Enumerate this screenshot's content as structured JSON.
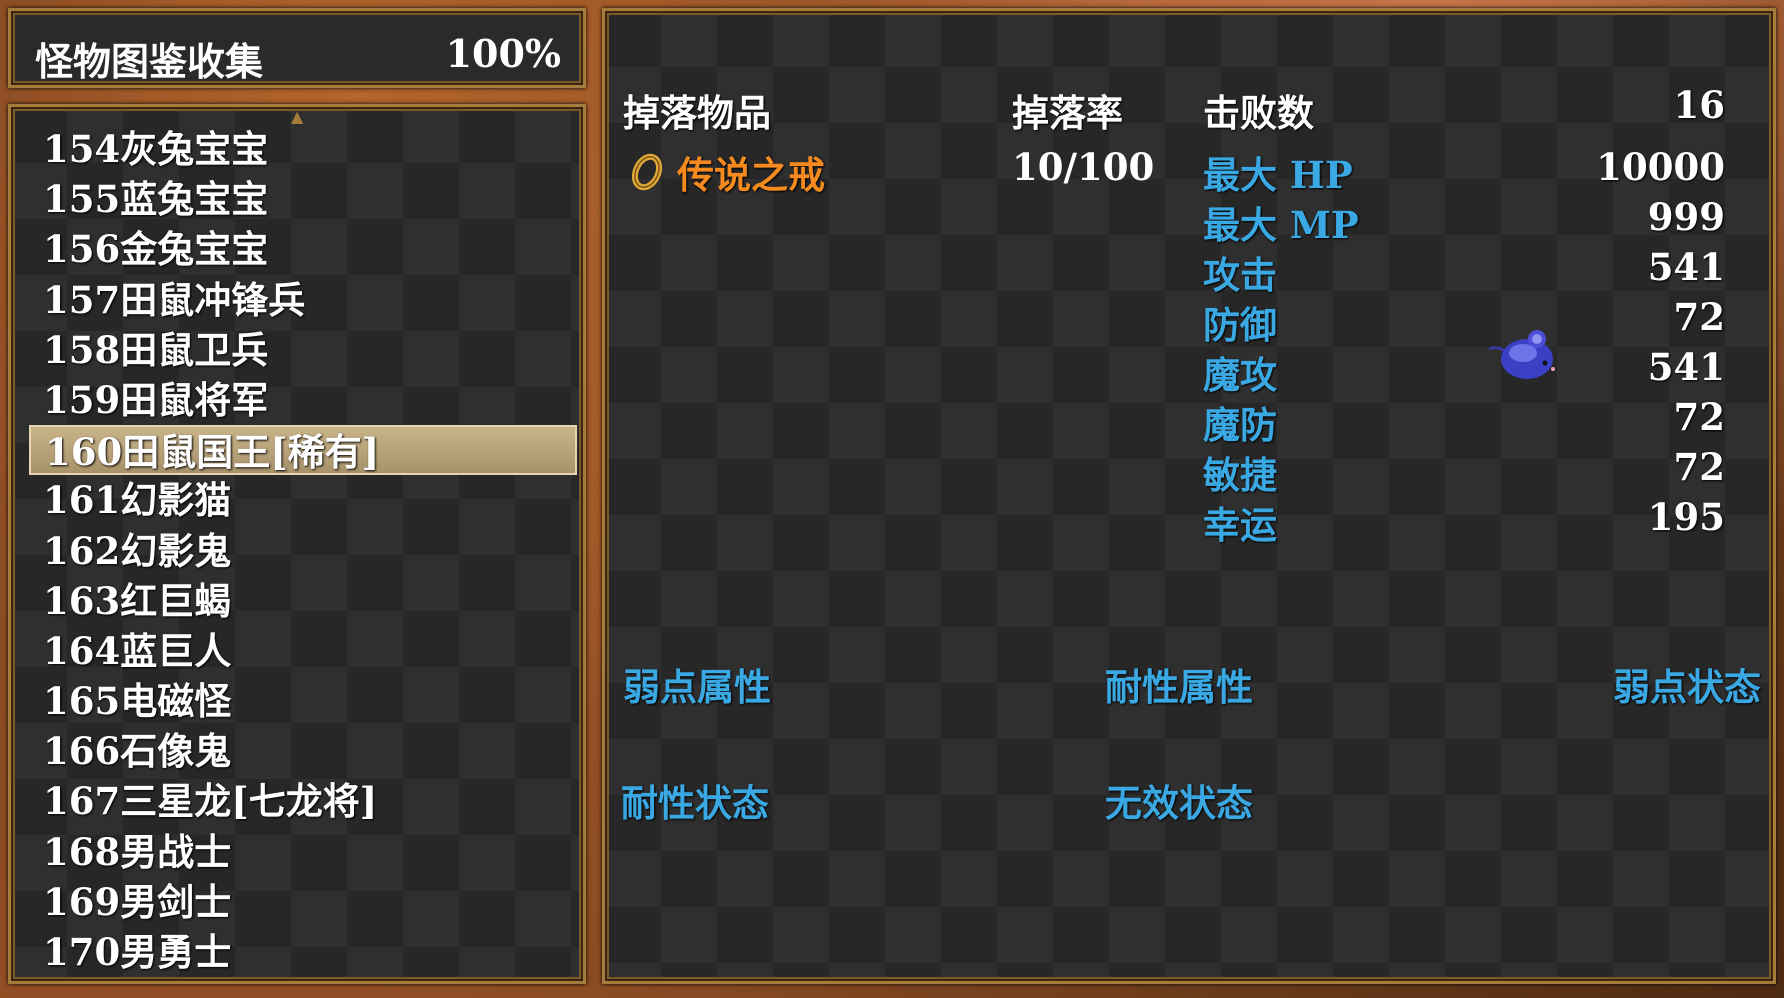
{
  "header": {
    "title": "怪物图鉴收集",
    "percent": "100%"
  },
  "monster_list": [
    "154灰兔宝宝",
    "155蓝兔宝宝",
    "156金兔宝宝",
    "157田鼠冲锋兵",
    "158田鼠卫兵",
    "159田鼠将军",
    "160田鼠国王[稀有]",
    "161幻影猫",
    "162幻影鬼",
    "163红巨蝎",
    "164蓝巨人",
    "165电磁怪",
    "166石像鬼",
    "167三星龙[七龙将]",
    "168男战士",
    "169男剑士",
    "170男勇士"
  ],
  "selected_index": 6,
  "detail": {
    "drop_header": "掉落物品",
    "rate_header": "掉落率",
    "defeat_label": "击败数",
    "defeat_count": "16",
    "drop": {
      "name": "传说之戒",
      "rate": "10/100",
      "icon": "ring-icon"
    },
    "stats": [
      {
        "label": "最大 HP",
        "value": "10000"
      },
      {
        "label": "最大 MP",
        "value": "999"
      },
      {
        "label": "攻击",
        "value": "541"
      },
      {
        "label": "防御",
        "value": "72"
      },
      {
        "label": "魔攻",
        "value": "541"
      },
      {
        "label": "魔防",
        "value": "72"
      },
      {
        "label": "敏捷",
        "value": "72"
      },
      {
        "label": "幸运",
        "value": "195"
      }
    ],
    "attributes": {
      "weak_element": "弱点属性",
      "resist_element": "耐性属性",
      "weak_state": "弱点状态",
      "resist_state": "耐性状态",
      "immune_state": "无效状态"
    },
    "monster_sprite": "blue-mouse-sprite"
  },
  "colors": {
    "stat_label": "#3aa8e2",
    "drop_item": "#f58a1f",
    "window_border": "#a67c3d",
    "selection": "#c9b48a"
  }
}
